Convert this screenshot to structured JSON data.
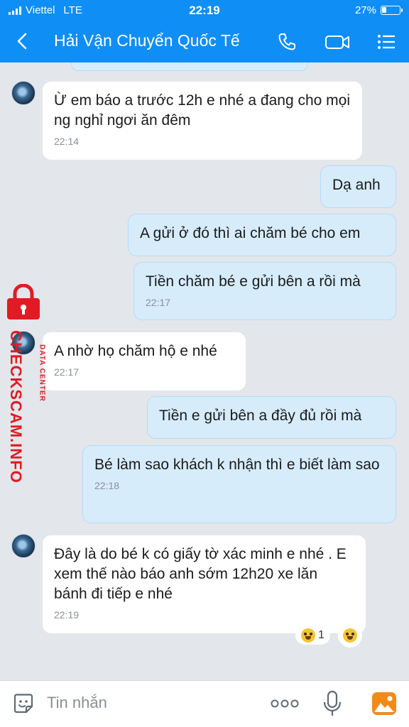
{
  "status_bar": {
    "carrier": "Viettel",
    "network": "LTE",
    "time": "22:19",
    "battery_text": "27%",
    "battery_level": 0.27
  },
  "header": {
    "contact_name": "Hải Vận Chuyển Quốc Tế",
    "icons": [
      "back-icon",
      "phone-icon",
      "video-call-icon",
      "menu-icon"
    ]
  },
  "messages": [
    {
      "from": "contact",
      "text": "Ừ em báo a trước 12h e nhé a đang cho mọi ng nghỉ ngơi ăn đêm",
      "time": "22:14"
    },
    {
      "from": "me",
      "text": "Dạ anh",
      "time": ""
    },
    {
      "from": "me",
      "text": "A gửi ở đó thì ai chăm bé cho em",
      "time": ""
    },
    {
      "from": "me",
      "text": "Tiền chăm bé e gửi bên a rồi mà",
      "time": "22:17"
    },
    {
      "from": "contact",
      "text": "A nhờ họ chăm hộ e nhé",
      "time": "22:17"
    },
    {
      "from": "me",
      "text": "Tiền e gửi bên a đầy đủ rồi mà",
      "time": ""
    },
    {
      "from": "me",
      "text": "Bé làm sao khách k nhận thì e biết làm sao",
      "time": "22:18"
    },
    {
      "from": "contact",
      "text": "Đây là do bé k có giấy tờ xác minh e nhé . E xem thế nào báo anh sớm 12h20 xe lăn bánh đi tiếp e nhé",
      "time": "22:19",
      "reaction_count": "1"
    }
  ],
  "watermark": {
    "brand": "CHECKSCAM.INFO",
    "sub": "DATA CENTER"
  },
  "input_bar": {
    "placeholder": "Tin nhắn",
    "icons": [
      "sticker-icon",
      "more-icon",
      "mic-icon",
      "photo-icon"
    ]
  },
  "colors": {
    "header_bg": "#0f8ef6",
    "chat_bg": "#e3e6ea",
    "outgoing_bubble": "#d6ecfb",
    "incoming_bubble": "#ffffff",
    "watermark": "#e01b24"
  }
}
